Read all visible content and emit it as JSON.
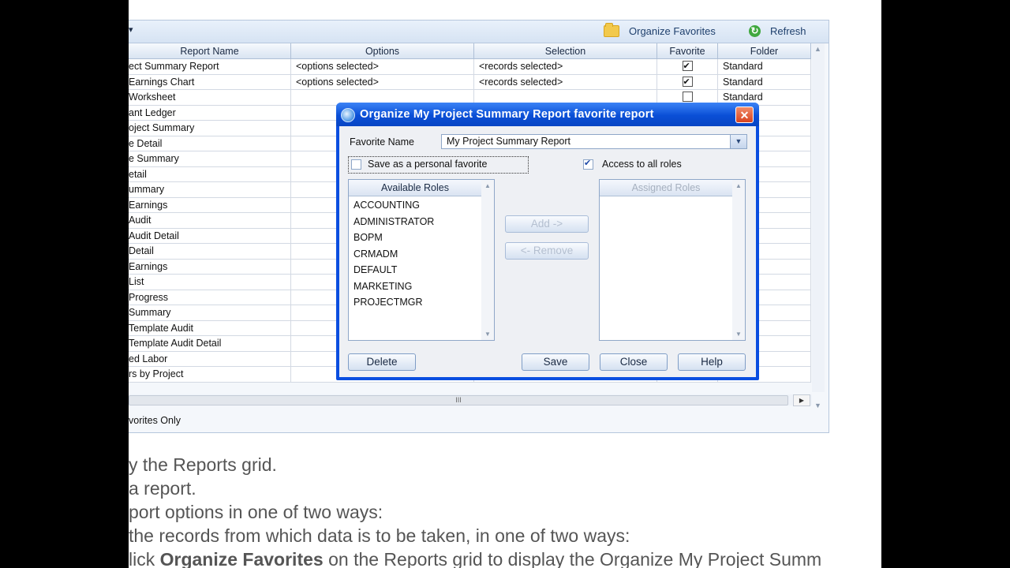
{
  "toolbar": {
    "collapse_glyph": "▾",
    "organize_label": "Organize Favorites",
    "refresh_label": "Refresh"
  },
  "grid": {
    "columns": [
      "Report Name",
      "Options",
      "Selection",
      "Favorite",
      "Folder"
    ],
    "rows": [
      {
        "name": "ect Summary Report",
        "options": "<options selected>",
        "selection": "<records selected>",
        "favorite": true,
        "folder": "Standard"
      },
      {
        "name": "Earnings Chart",
        "options": "<options selected>",
        "selection": "<records selected>",
        "favorite": true,
        "folder": "Standard"
      },
      {
        "name": " Worksheet",
        "options": "",
        "selection": "",
        "favorite": false,
        "folder": "Standard"
      },
      {
        "name": "ant Ledger",
        "options": "",
        "selection": "",
        "favorite": null,
        "folder": "d"
      },
      {
        "name": "oject Summary",
        "options": "",
        "selection": "",
        "favorite": null,
        "folder": "d"
      },
      {
        "name": "e Detail",
        "options": "",
        "selection": "",
        "favorite": null,
        "folder": "d"
      },
      {
        "name": "e Summary",
        "options": "",
        "selection": "",
        "favorite": null,
        "folder": "d"
      },
      {
        "name": "etail",
        "options": "",
        "selection": "",
        "favorite": null,
        "folder": "d"
      },
      {
        "name": "ummary",
        "options": "",
        "selection": "",
        "favorite": null,
        "folder": "d"
      },
      {
        "name": "Earnings",
        "options": "",
        "selection": "",
        "favorite": null,
        "folder": "d"
      },
      {
        "name": " Audit",
        "options": "",
        "selection": "",
        "favorite": null,
        "folder": "d"
      },
      {
        "name": " Audit Detail",
        "options": "",
        "selection": "",
        "favorite": null,
        "folder": "d"
      },
      {
        "name": " Detail",
        "options": "",
        "selection": "",
        "favorite": null,
        "folder": "d"
      },
      {
        "name": " Earnings",
        "options": "",
        "selection": "",
        "favorite": null,
        "folder": "d"
      },
      {
        "name": " List",
        "options": "",
        "selection": "",
        "favorite": null,
        "folder": "d"
      },
      {
        "name": " Progress",
        "options": "",
        "selection": "",
        "favorite": null,
        "folder": "d"
      },
      {
        "name": " Summary",
        "options": "",
        "selection": "",
        "favorite": null,
        "folder": "d"
      },
      {
        "name": " Template Audit",
        "options": "",
        "selection": "",
        "favorite": null,
        "folder": "d"
      },
      {
        "name": " Template Audit Detail",
        "options": "",
        "selection": "",
        "favorite": null,
        "folder": "d"
      },
      {
        "name": "ed Labor",
        "options": "",
        "selection": "",
        "favorite": null,
        "folder": "d"
      },
      {
        "name": "rs by Project",
        "options": "",
        "selection": "",
        "favorite": null,
        "folder": "d"
      }
    ],
    "hscroll_grip": "III",
    "favorites_only_label": "vorites Only"
  },
  "dialog": {
    "title": "Organize My Project Summary Report favorite report",
    "close_glyph": "✕",
    "favorite_name_label": "Favorite Name",
    "favorite_name_value": "My Project Summary Report",
    "personal_favorite_label": "Save as a personal favorite",
    "personal_favorite_checked": false,
    "access_all_roles_label": "Access to all roles",
    "access_all_roles_checked": true,
    "available_roles_header": "Available Roles",
    "available_roles": [
      "ACCOUNTING",
      "ADMINISTRATOR",
      "BOPM",
      "CRMADM",
      "DEFAULT",
      "MARKETING",
      "PROJECTMGR"
    ],
    "assigned_roles_header": "Assigned Roles",
    "assigned_roles": [],
    "add_label": "Add ->",
    "remove_label": "<- Remove",
    "delete_label": "Delete",
    "save_label": "Save",
    "close_label": "Close",
    "help_label": "Help"
  },
  "instructions": {
    "line1": "y the Reports grid.",
    "line2": " a report.",
    "line3": "port options in one of two ways:",
    "line4": " the records from which data is to be taken, in one of two ways:",
    "line5_pre": "lick ",
    "line5_bold": "Organize Favorites",
    "line5_post": " on the Reports grid to display the Organize My Project Summ"
  },
  "colors": {
    "dialog_frame": "#0a4ee0",
    "grid_header": "#d9e4f2",
    "instruction_text": "#555555"
  }
}
